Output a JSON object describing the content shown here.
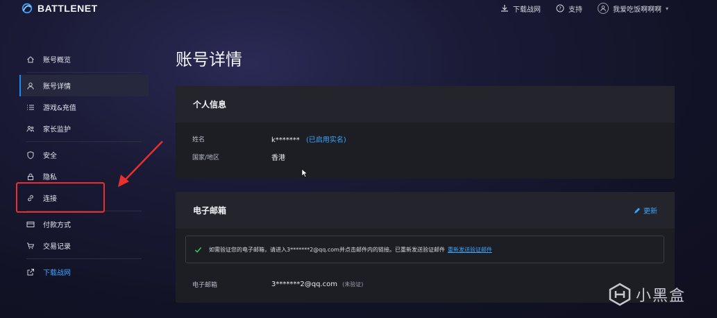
{
  "header": {
    "brand": "BATTLENET",
    "download_label": "下载战网",
    "support_label": "支持",
    "user_name": "我爱吃饭啊啊啊"
  },
  "sidebar": {
    "items": [
      {
        "label": "账号概览",
        "icon": "home-icon"
      },
      {
        "label": "账号详情",
        "icon": "user-icon"
      },
      {
        "label": "游戏&充值",
        "icon": "list-icon"
      },
      {
        "label": "家长监护",
        "icon": "family-icon"
      },
      {
        "label": "安全",
        "icon": "shield-icon"
      },
      {
        "label": "隐私",
        "icon": "lock-icon"
      },
      {
        "label": "连接",
        "icon": "link-icon"
      },
      {
        "label": "付款方式",
        "icon": "card-icon"
      },
      {
        "label": "交易记录",
        "icon": "cart-icon"
      },
      {
        "label": "下载战网",
        "icon": "external-icon"
      }
    ],
    "active_index": 1
  },
  "main": {
    "title": "账号详情",
    "personal": {
      "heading": "个人信息",
      "name_label": "姓名",
      "name_value": "k*******",
      "name_badge": "(已启用实名)",
      "region_label": "国家/地区",
      "region_value": "香港"
    },
    "email": {
      "heading": "电子邮箱",
      "edit_label": "更新",
      "notice_text": "如需验证您的电子邮箱，请进入3*******2@qq.com并点击邮件内的链接。已重新发送验证邮件",
      "notice_link": "重新发送验证邮件",
      "email_label": "电子邮箱",
      "email_value": "3*******2@qq.com",
      "email_status": "(未验证)"
    }
  },
  "watermark": {
    "text": "小黑盒"
  },
  "colors": {
    "accent": "#1a8df0",
    "link": "#3aa5ff",
    "annotation": "#e8302f"
  }
}
